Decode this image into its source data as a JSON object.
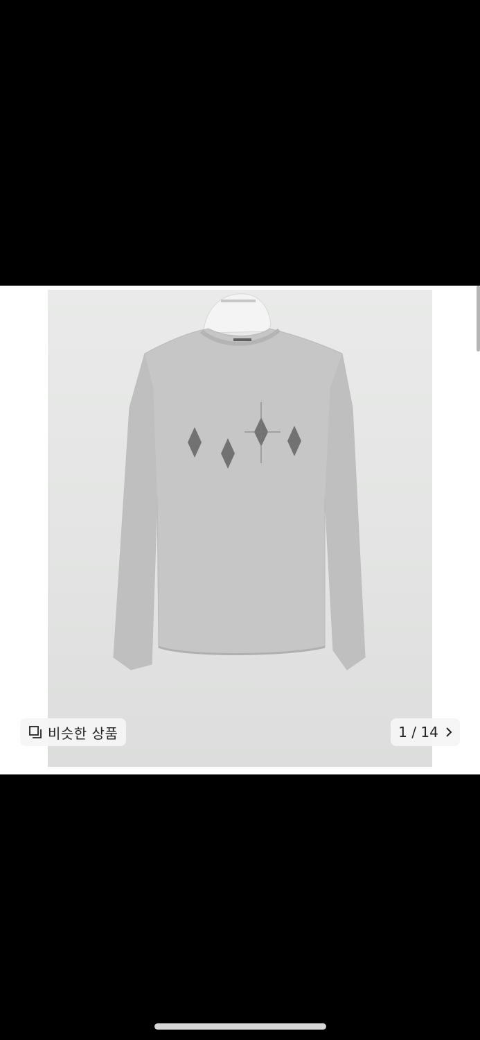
{
  "viewer": {
    "similar_products_label": "비슷한 상품",
    "similar_products_icon": "similar-items-icon",
    "counter_text": "1 / 14",
    "next_icon": "chevron-right-icon"
  },
  "product_image": {
    "garment_color": "#c9c9c9",
    "motif_color": "#6a6a6a"
  }
}
